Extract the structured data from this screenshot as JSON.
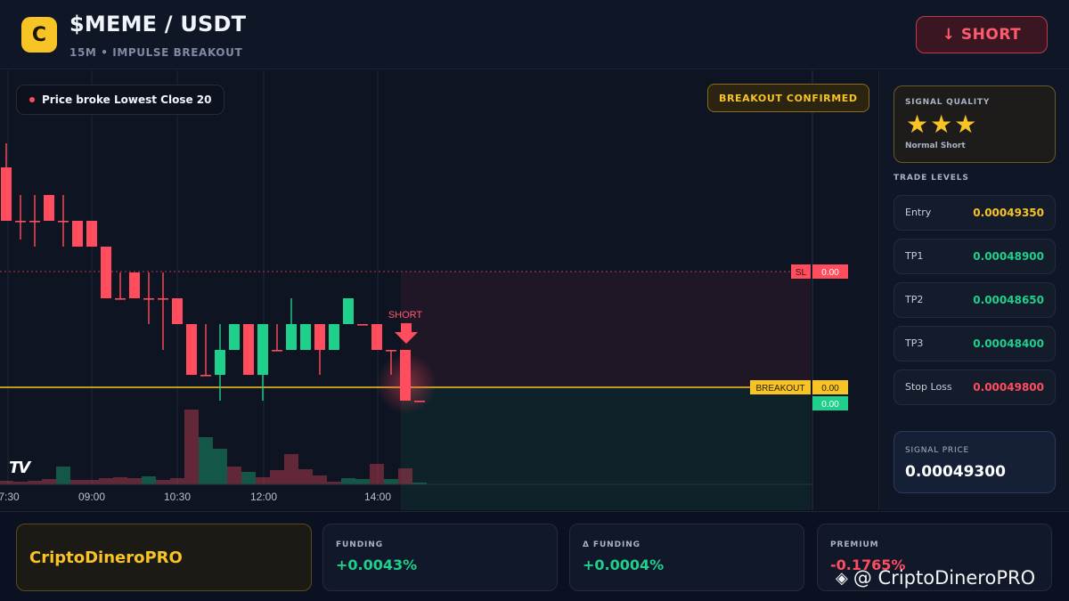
{
  "header": {
    "logo_letter": "C",
    "pair": "$MEME / USDT",
    "subtitle": "15M • IMPULSE BREAKOUT",
    "short_button": "↓ SHORT"
  },
  "chart": {
    "event_pill": "Price broke Lowest Close 20",
    "confirmed_badge": "BREAKOUT CONFIRMED",
    "short_marker_label": "SHORT",
    "sl_tag": "SL",
    "sl_value": "0.00",
    "breakout_tag": "BREAKOUT",
    "breakout_value": "0.00",
    "current_value": "0.00",
    "tv_logo": "TV"
  },
  "chart_data": {
    "type": "candlestick",
    "x_ticks": [
      "7:30",
      "09:00",
      "10:30",
      "12:00",
      "14:00"
    ],
    "levels": {
      "stop_loss": 0.000498,
      "breakout": 0.0004935
    },
    "colors": {
      "up": "#1fd08c",
      "down": "#ff4d5e",
      "level": "#f7c325"
    }
  },
  "sidebar": {
    "quality_label": "SIGNAL QUALITY",
    "stars": "★★★",
    "stars_count": 3,
    "quality_sub": "Normal Short",
    "levels_label": "TRADE LEVELS",
    "levels": [
      {
        "name": "Entry",
        "value": "0.00049350",
        "color": "#f7c325"
      },
      {
        "name": "TP1",
        "value": "0.00048900",
        "color": "#1fd08c"
      },
      {
        "name": "TP2",
        "value": "0.00048650",
        "color": "#1fd08c"
      },
      {
        "name": "TP3",
        "value": "0.00048400",
        "color": "#1fd08c"
      },
      {
        "name": "Stop Loss",
        "value": "0.00049800",
        "color": "#ff4d5e"
      }
    ],
    "signal_price_label": "SIGNAL PRICE",
    "signal_price": "0.00049300"
  },
  "footer": {
    "brand": "CriptoDineroPRO",
    "stats": [
      {
        "label": "FUNDING",
        "value": "+0.0043%",
        "color": "#1fd08c"
      },
      {
        "label": "Δ FUNDING",
        "value": "+0.0004%",
        "color": "#1fd08c"
      },
      {
        "label": "PREMIUM",
        "value": "-0.1765%",
        "color": "#ff4d5e"
      }
    ],
    "watermark": "@ CriptoDineroPRO"
  }
}
